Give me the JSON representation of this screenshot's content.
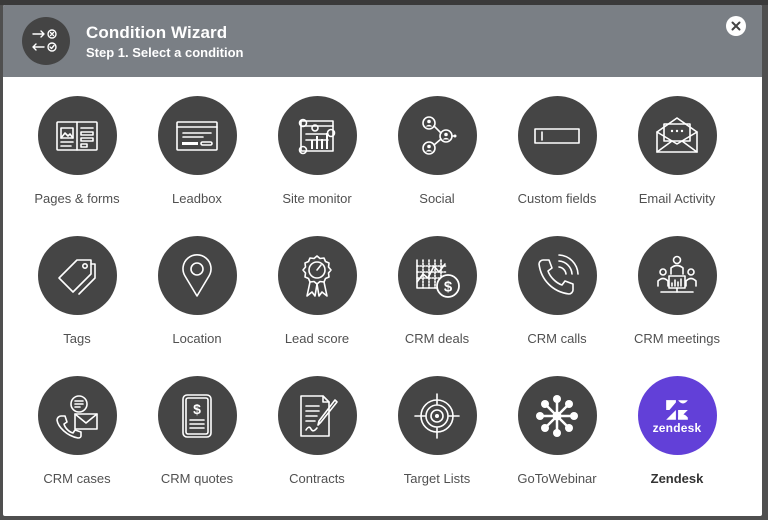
{
  "header": {
    "title": "Condition Wizard",
    "subtitle": "Step 1. Select a condition",
    "icon": "conditions-icon",
    "close_icon": "close-icon"
  },
  "colors": {
    "header_bg": "#7a7f85",
    "circle_bg": "#454545",
    "zendesk_bg": "#6240d8"
  },
  "conditions": [
    {
      "label": "Pages & forms",
      "icon": "pages-forms-icon"
    },
    {
      "label": "Leadbox",
      "icon": "leadbox-icon"
    },
    {
      "label": "Site monitor",
      "icon": "site-monitor-icon"
    },
    {
      "label": "Social",
      "icon": "social-icon"
    },
    {
      "label": "Custom fields",
      "icon": "custom-fields-icon"
    },
    {
      "label": "Email Activity",
      "icon": "email-activity-icon"
    },
    {
      "label": "Tags",
      "icon": "tags-icon"
    },
    {
      "label": "Location",
      "icon": "location-icon"
    },
    {
      "label": "Lead score",
      "icon": "lead-score-icon"
    },
    {
      "label": "CRM deals",
      "icon": "crm-deals-icon"
    },
    {
      "label": "CRM calls",
      "icon": "crm-calls-icon"
    },
    {
      "label": "CRM meetings",
      "icon": "crm-meetings-icon"
    },
    {
      "label": "CRM cases",
      "icon": "crm-cases-icon"
    },
    {
      "label": "CRM quotes",
      "icon": "crm-quotes-icon"
    },
    {
      "label": "Contracts",
      "icon": "contracts-icon"
    },
    {
      "label": "Target Lists",
      "icon": "target-lists-icon"
    },
    {
      "label": "GoToWebinar",
      "icon": "gotowebinar-icon"
    },
    {
      "label": "Zendesk",
      "icon": "zendesk-logo-icon",
      "logo_text": "zendesk"
    }
  ]
}
